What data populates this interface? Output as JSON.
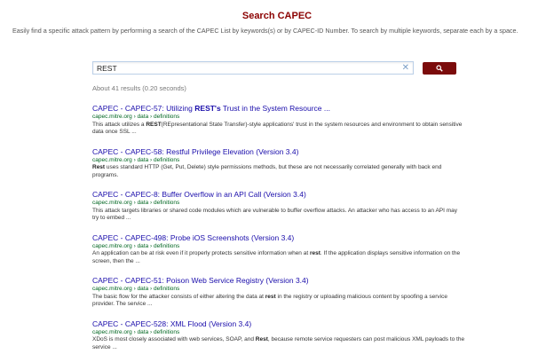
{
  "page": {
    "title": "Search CAPEC",
    "description": "Easily find a specific attack pattern by performing a search of the CAPEC List by keywords(s) or by CAPEC-ID Number. To search by multiple keywords, separate each by a space."
  },
  "search": {
    "value": "REST",
    "clear_symbol": "✕"
  },
  "results_summary": "About 41 results (0.20 seconds)",
  "colors": {
    "title": "#8b0000",
    "search_button": "#7b0b0b",
    "link": "#1a0dab",
    "breadcrumb": "#006621"
  },
  "results": [
    {
      "title_pre": "CAPEC - CAPEC-57: Utilizing ",
      "title_bold": "REST's",
      "title_post": " Trust in the System Resource ...",
      "breadcrumb": "capec.mitre.org › data › definitions",
      "snip_a": "This attack utilizes a ",
      "snip_b": "REST",
      "snip_c": "(REpresentational State Transfer)-style applications' trust in the system resources and environment to obtain sensitive data once SSL  ..."
    },
    {
      "title_pre": "CAPEC - CAPEC-58: Restful Privilege Elevation (Version 3.4)",
      "title_bold": "",
      "title_post": "",
      "breadcrumb": "capec.mitre.org › data › definitions",
      "snip_a": "",
      "snip_b": "Rest",
      "snip_c": " uses standard HTTP (Get, Put, Delete) style permissions methods, but these are not necessarily correlated generally with back end programs."
    },
    {
      "title_pre": "CAPEC - CAPEC-8: Buffer Overflow in an API Call (Version 3.4)",
      "title_bold": "",
      "title_post": "",
      "breadcrumb": "capec.mitre.org › data › definitions",
      "snip_a": "This attack targets libraries or shared code modules which are vulnerable to buffer overflow attacks. An attacker who has access to an API may try to embed ...",
      "snip_b": "",
      "snip_c": ""
    },
    {
      "title_pre": "CAPEC - CAPEC-498: Probe iOS Screenshots (Version 3.4)",
      "title_bold": "",
      "title_post": "",
      "breadcrumb": "capec.mitre.org › data › definitions",
      "snip_a": "An application can be at risk even if it properly protects sensitive information when at ",
      "snip_b": "rest",
      "snip_c": ". If the application displays sensitive information on the screen, then the ..."
    },
    {
      "title_pre": "CAPEC - CAPEC-51: Poison Web Service Registry (Version 3.4)",
      "title_bold": "",
      "title_post": "",
      "breadcrumb": "capec.mitre.org › data › definitions",
      "snip_a": "The basic flow for the attacker consists of either altering the data at ",
      "snip_b": "rest",
      "snip_c": " in the registry or uploading malicious content by spoofing a service provider. The service ..."
    },
    {
      "title_pre": "CAPEC - CAPEC-528: XML Flood (Version 3.4)",
      "title_bold": "",
      "title_post": "",
      "breadcrumb": "capec.mitre.org › data › definitions",
      "snip_a": "XDoS is most closely associated with web services, SOAP, and ",
      "snip_b": "Rest",
      "snip_c": ", because remote service requesters can post malicious XML payloads to the service ..."
    }
  ]
}
